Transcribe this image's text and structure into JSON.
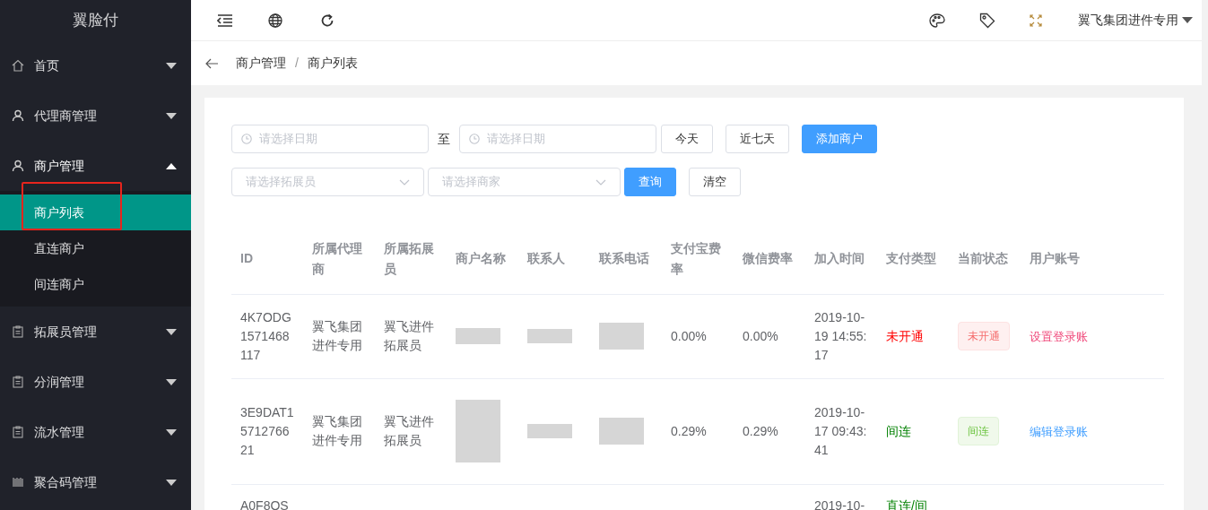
{
  "sidebar": {
    "logo": "翼脸付",
    "items": [
      {
        "label": "首页",
        "kind": "home",
        "expanded": false
      },
      {
        "label": "代理商管理",
        "kind": "user",
        "expanded": false
      },
      {
        "label": "商户管理",
        "kind": "user",
        "expanded": true,
        "children": [
          {
            "label": "商户列表",
            "selected": true
          },
          {
            "label": "直连商户",
            "selected": false
          },
          {
            "label": "间连商户",
            "selected": false
          }
        ]
      },
      {
        "label": "拓展员管理",
        "kind": "clipboard",
        "expanded": false
      },
      {
        "label": "分润管理",
        "kind": "clipboard",
        "expanded": false
      },
      {
        "label": "流水管理",
        "kind": "clipboard",
        "expanded": false
      },
      {
        "label": "聚合码管理",
        "kind": "barcode",
        "expanded": false
      }
    ]
  },
  "top_bar": {
    "user": "翼飞集团进件专用"
  },
  "breadcrumb": {
    "items": [
      "商户管理",
      "商户列表"
    ],
    "separator": "/"
  },
  "filters": {
    "date_start": {
      "placeholder": "请选择日期"
    },
    "to_label": "至",
    "date_end": {
      "placeholder": "请选择日期"
    },
    "quick_buttons": [
      {
        "label": "今天",
        "kind": "plain"
      },
      {
        "label": "近七天",
        "kind": "plain"
      },
      {
        "label": "添加商户",
        "kind": "primary"
      }
    ],
    "expander_select": {
      "placeholder": "请选择拓展员"
    },
    "merchant_select": {
      "placeholder": "请选择商家"
    },
    "action_buttons": [
      {
        "label": "查询",
        "kind": "primary"
      },
      {
        "label": "清空",
        "kind": "plain"
      }
    ]
  },
  "table": {
    "columns": [
      "ID",
      "所属代理商",
      "所属拓展员",
      "商户名称",
      "联系人",
      "联系电话",
      "支付宝费率",
      "微信费率",
      "加入时间",
      "支付类型",
      "当前状态",
      "用户账号"
    ],
    "rows": [
      {
        "id": "4K7ODG1571468117",
        "agent": "翼飞集团进件专用",
        "expander": "翼飞进件拓展员",
        "alipay_rate": "0.00%",
        "wechat_rate": "0.00%",
        "joined": "2019-10-19 14:55:17",
        "pay_type": {
          "text": "未开通",
          "color": "#ff0000"
        },
        "status": {
          "text": "未开通",
          "kind": "danger"
        },
        "account": {
          "text": "设置登录账",
          "kind": "danger"
        }
      },
      {
        "id": "3E9DAT1571276621",
        "agent": "翼飞集团进件专用",
        "expander": "翼飞进件拓展员",
        "alipay_rate": "0.29%",
        "wechat_rate": "0.29%",
        "joined": "2019-10-17 09:43:41",
        "pay_type": {
          "text": "间连",
          "color": "#008000"
        },
        "status": {
          "text": "间连",
          "kind": "success"
        },
        "account": {
          "text": "编辑登录账",
          "kind": "primary"
        }
      },
      {
        "id": "A0F8OS",
        "joined": "2019-10-",
        "pay_type": {
          "text": "直连/间",
          "color": "#008000"
        }
      }
    ]
  }
}
